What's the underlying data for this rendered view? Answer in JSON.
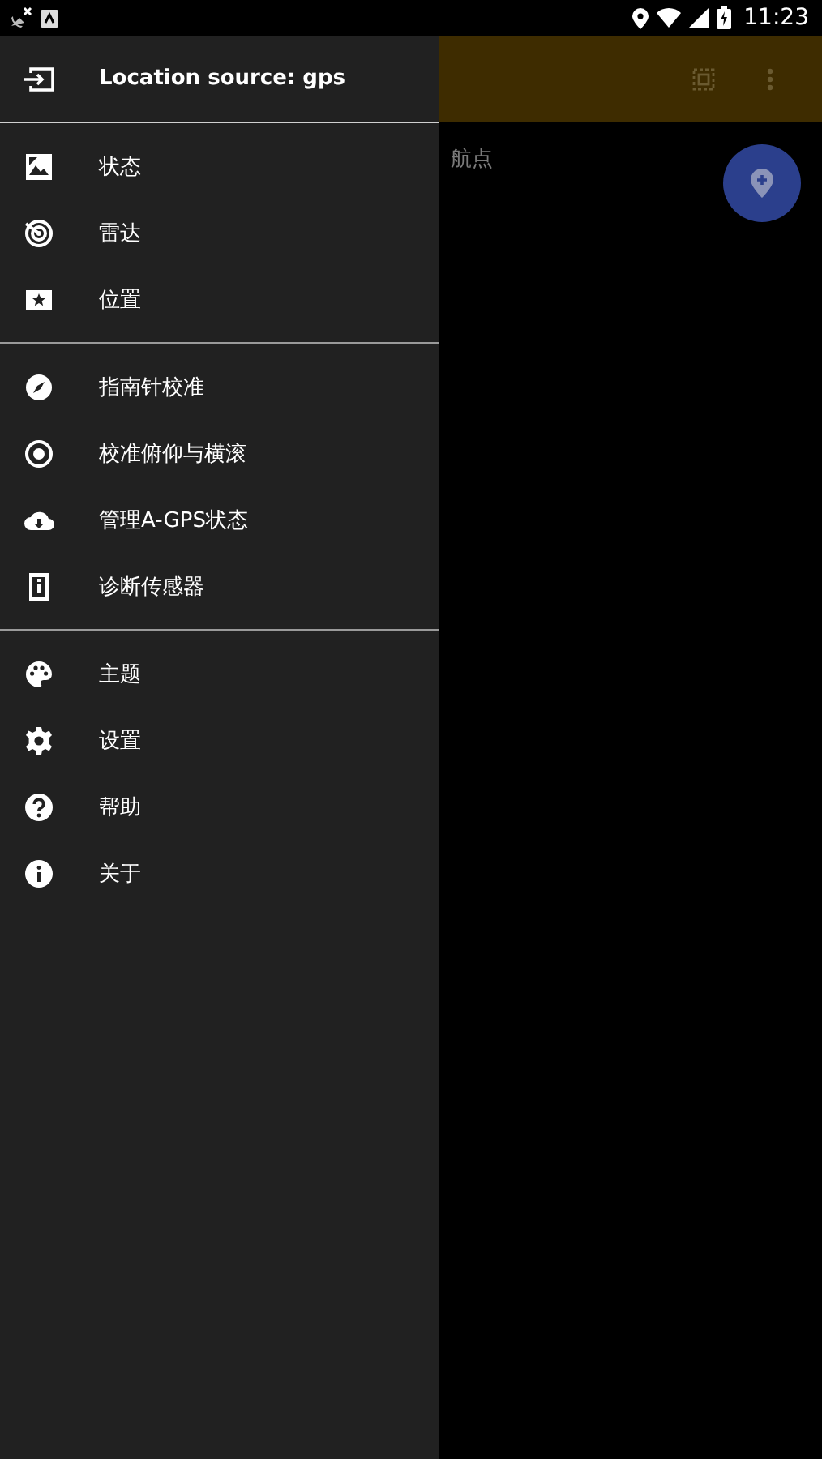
{
  "status_bar": {
    "time": "11:23"
  },
  "background": {
    "partial_text": "航点"
  },
  "drawer": {
    "header": "Location source: gps",
    "groups": [
      [
        {
          "label": "状态"
        },
        {
          "label": "雷达"
        },
        {
          "label": "位置"
        }
      ],
      [
        {
          "label": "指南针校准"
        },
        {
          "label": "校准俯仰与横滚"
        },
        {
          "label": "管理A-GPS状态"
        },
        {
          "label": "诊断传感器"
        }
      ],
      [
        {
          "label": "主题"
        },
        {
          "label": "设置"
        },
        {
          "label": "帮助"
        },
        {
          "label": "关于"
        }
      ]
    ]
  }
}
